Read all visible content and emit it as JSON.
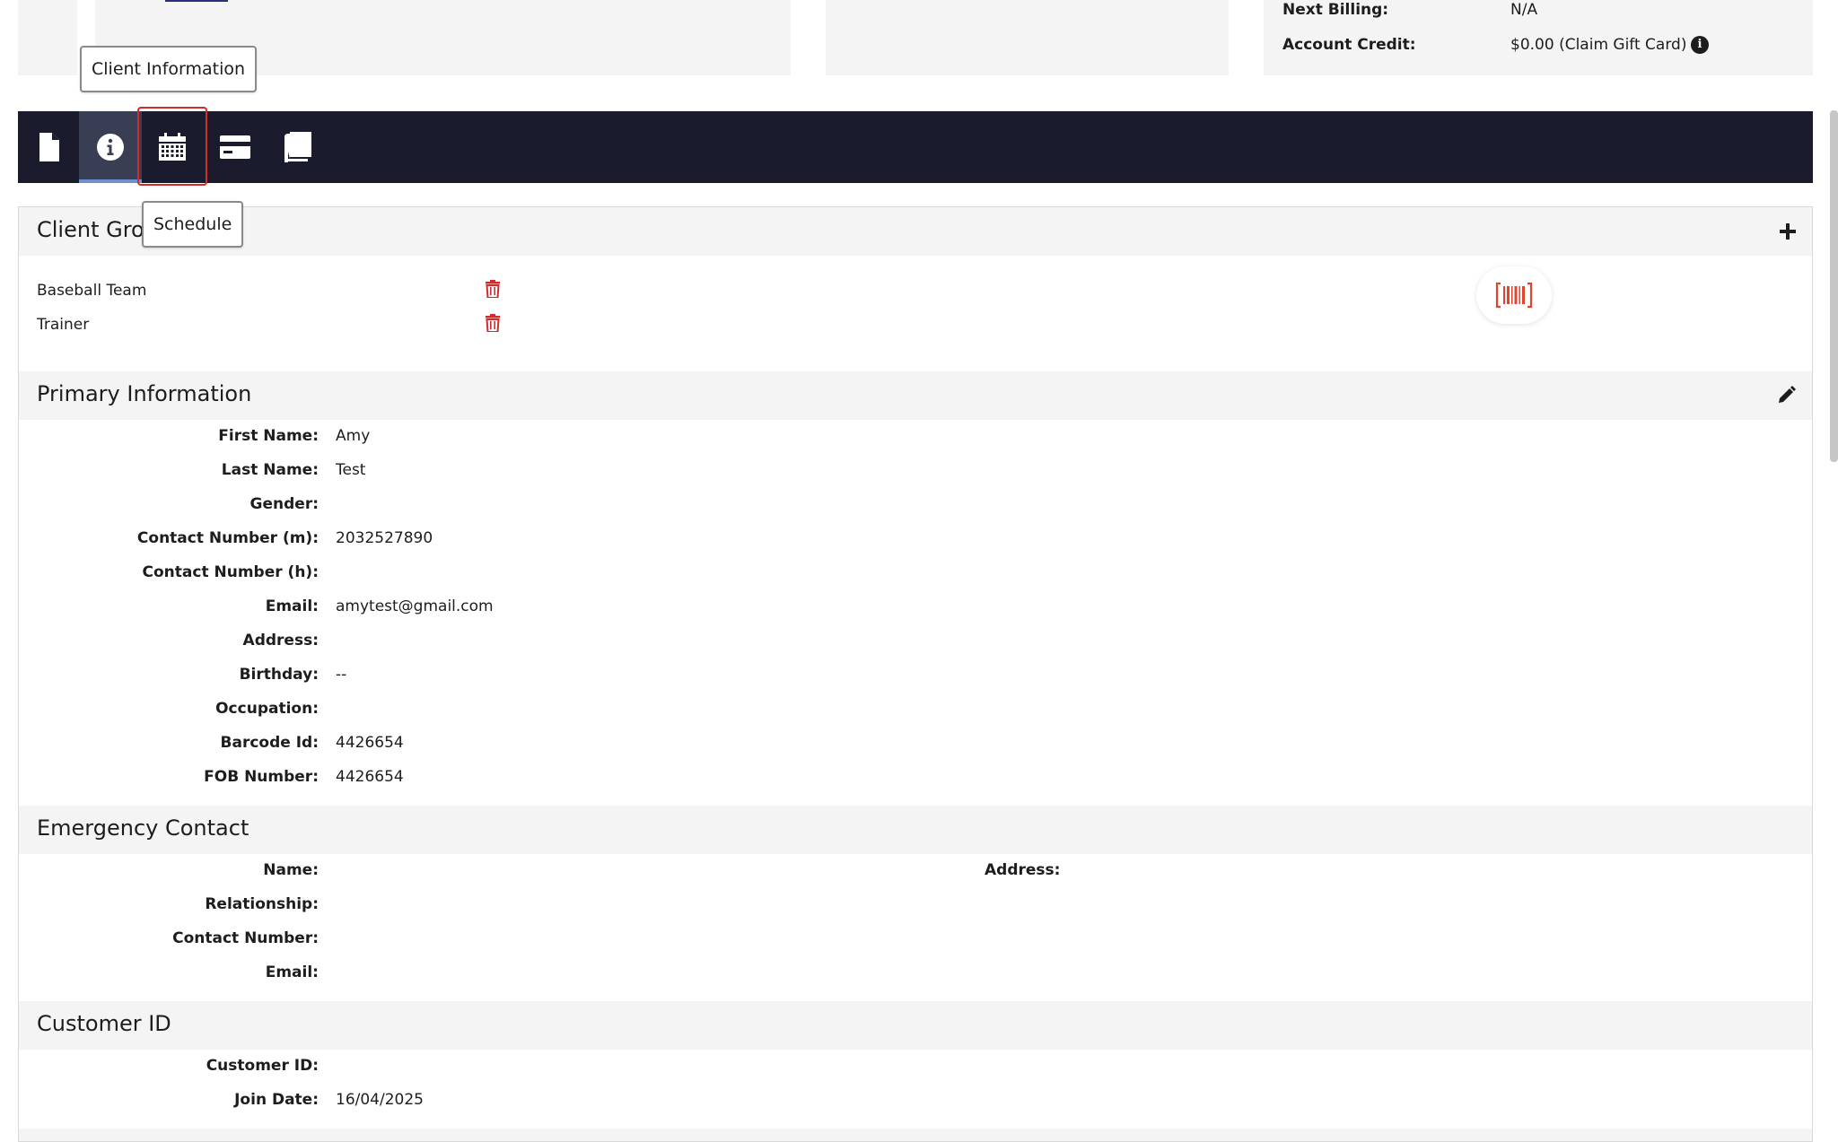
{
  "billing": {
    "next_billing_label": "Next Billing:",
    "next_billing_value": "N/A",
    "account_credit_label": "Account Credit:",
    "account_credit_value": "$0.00 (Claim Gift Card)"
  },
  "tooltips": {
    "client_information": "Client Information",
    "schedule": "Schedule"
  },
  "toolbar": {
    "icons": [
      "document-icon",
      "info-icon",
      "calendar-icon",
      "credit-card-icon",
      "book-icon"
    ],
    "active": "info-icon",
    "highlight_color": "#d42a2a",
    "background": "#1a1c2e"
  },
  "client_groups": {
    "title": "Client Grou",
    "items": [
      {
        "name": "Baseball Team"
      },
      {
        "name": "Trainer"
      }
    ]
  },
  "primary_information": {
    "title": "Primary Information",
    "fields": [
      {
        "label": "First Name:",
        "value": "Amy"
      },
      {
        "label": "Last Name:",
        "value": "Test"
      },
      {
        "label": "Gender:",
        "value": ""
      },
      {
        "label": "Contact Number (m):",
        "value": "2032527890"
      },
      {
        "label": "Contact Number (h):",
        "value": ""
      },
      {
        "label": "Email:",
        "value": "amytest@gmail.com"
      },
      {
        "label": "Address:",
        "value": ""
      },
      {
        "label": "Birthday:",
        "value": "--"
      },
      {
        "label": "Occupation:",
        "value": ""
      },
      {
        "label": "Barcode Id:",
        "value": "4426654"
      },
      {
        "label": "FOB Number:",
        "value": "4426654"
      }
    ]
  },
  "emergency_contact": {
    "title": "Emergency Contact",
    "fields": [
      {
        "label": "Name:",
        "value": ""
      },
      {
        "label": "Relationship:",
        "value": ""
      },
      {
        "label": "Contact Number:",
        "value": ""
      },
      {
        "label": "Email:",
        "value": ""
      }
    ],
    "address_label": "Address:"
  },
  "customer_id": {
    "title": "Customer ID",
    "fields": [
      {
        "label": "Customer ID:",
        "value": ""
      },
      {
        "label": "Join Date:",
        "value": "16/04/2025"
      }
    ]
  },
  "colors": {
    "trash": "#d42a2a",
    "barcode": "#e0442e",
    "section_bg": "#f4f4f4"
  }
}
